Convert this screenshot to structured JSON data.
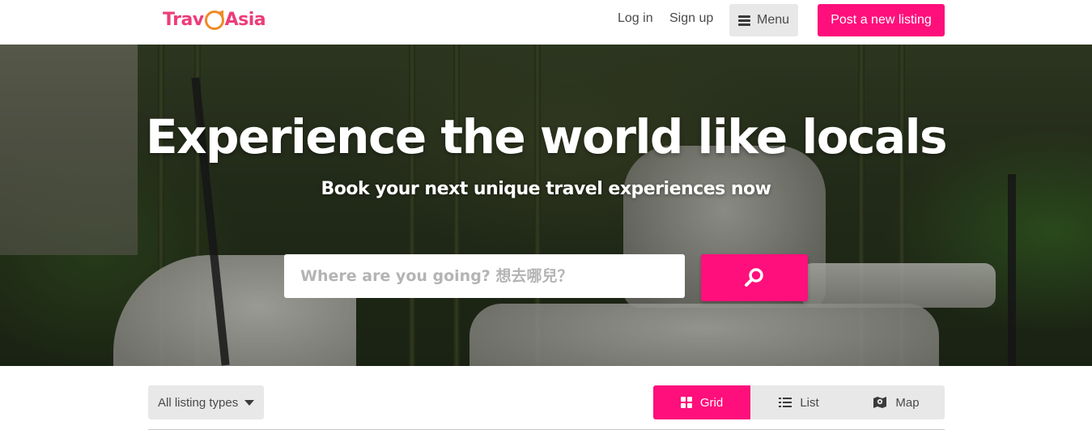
{
  "header": {
    "logo": {
      "part1": "Trav",
      "part2": "Asia"
    },
    "login_label": "Log in",
    "signup_label": "Sign up",
    "menu_label": "Menu",
    "post_label": "Post a new listing"
  },
  "hero": {
    "title": "Experience the world like locals",
    "subtitle": "Book your next unique travel experiences now",
    "search_placeholder": "Where are you going? 想去哪兒？",
    "search_value": ""
  },
  "filters": {
    "listing_types_label": "All listing types",
    "views": [
      {
        "label": "Grid",
        "icon": "grid-icon",
        "active": true
      },
      {
        "label": "List",
        "icon": "list-icon",
        "active": false
      },
      {
        "label": "Map",
        "icon": "map-icon",
        "active": false
      }
    ]
  },
  "colors": {
    "brand_pink": "#ff0f7b",
    "logo_pink": "#ec3d7a",
    "logo_orange": "#f08a26",
    "button_gray": "#e8e8e8"
  }
}
